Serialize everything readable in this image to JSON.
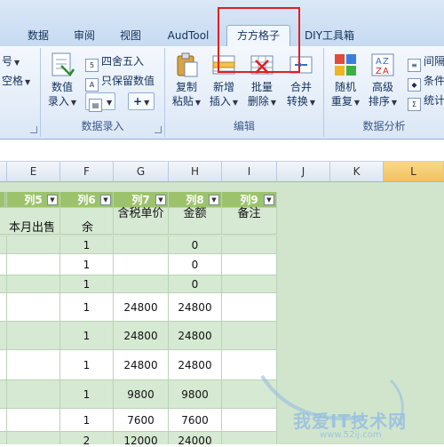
{
  "tabs": [
    "数据",
    "审阅",
    "视图",
    "AudTool",
    "方方格子",
    "DIY工具箱"
  ],
  "ribbon": {
    "left_partial": [
      "号",
      "空格"
    ],
    "g_input": {
      "label": "数据录入",
      "big_button": [
        "数值",
        "录入"
      ],
      "round": "四舍五入",
      "keep_num": "只保留数值"
    },
    "g_edit": {
      "label": "编辑",
      "buttons": [
        {
          "l1": "复制",
          "l2": "粘贴"
        },
        {
          "l1": "新增",
          "l2": "插入"
        },
        {
          "l1": "批量",
          "l2": "删除"
        },
        {
          "l1": "合并",
          "l2": "转换"
        }
      ]
    },
    "g_analysis": {
      "label": "数据分析",
      "buttons": [
        {
          "l1": "随机",
          "l2": "重复"
        },
        {
          "l1": "高级",
          "l2": "排序"
        }
      ],
      "small": [
        "间隔",
        "条件",
        "统计"
      ]
    }
  },
  "colors": {
    "accent_red": "#e02020",
    "header_green": "#9cc36b",
    "band_green": "#d6e9d2",
    "sheet_bg": "#d0e5cc"
  },
  "sheet": {
    "columns": [
      "E",
      "F",
      "G",
      "H",
      "I",
      "J",
      "K",
      "L"
    ],
    "filter_headers": [
      "列5",
      "列6",
      "列7",
      "列8",
      "列9"
    ],
    "subheaders": [
      "本月出售",
      "余",
      "含税单价",
      "金额",
      "备注"
    ],
    "rows": [
      [
        "",
        "1",
        "",
        "0",
        ""
      ],
      [
        "",
        "1",
        "",
        "0",
        ""
      ],
      [
        "",
        "1",
        "",
        "0",
        ""
      ],
      [
        "",
        "1",
        "24800",
        "24800",
        ""
      ],
      [
        "",
        "1",
        "24800",
        "24800",
        ""
      ],
      [
        "",
        "1",
        "24800",
        "24800",
        ""
      ],
      [
        "",
        "1",
        "9800",
        "9800",
        ""
      ],
      [
        "",
        "1",
        "7600",
        "7600",
        ""
      ],
      [
        "",
        "2",
        "12000",
        "24000",
        ""
      ]
    ]
  },
  "watermark": {
    "text": "我爱IT技术网",
    "url": "www.52ij.com"
  }
}
